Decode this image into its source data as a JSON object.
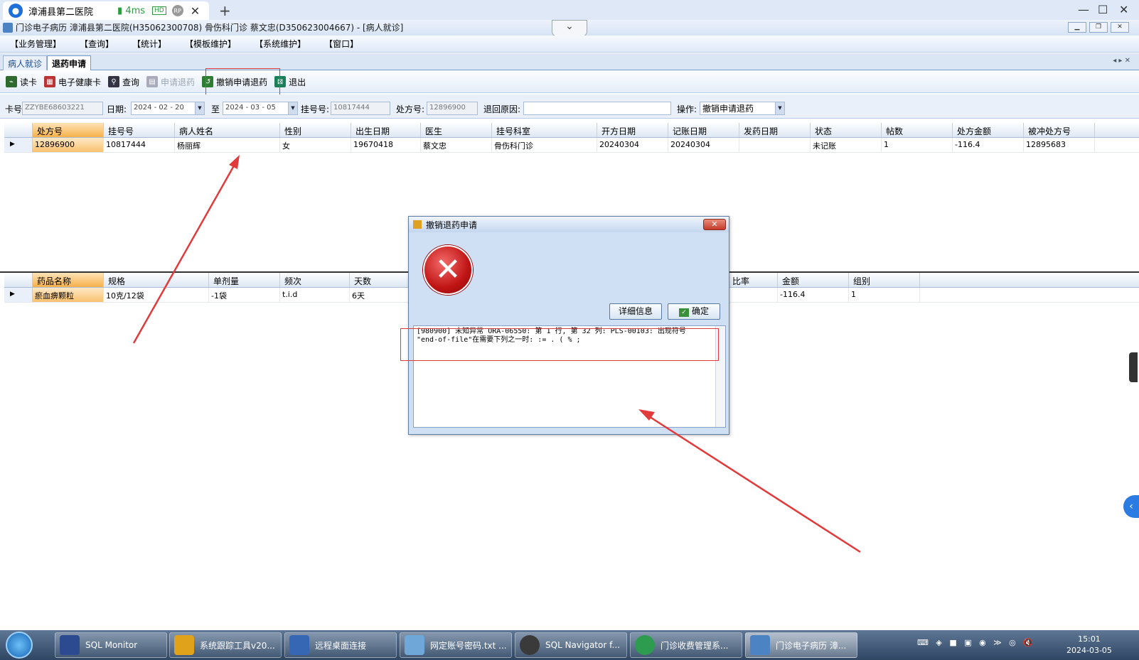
{
  "browser": {
    "tab_title": "漳浦县第二医院",
    "latency": "4ms",
    "hd": "HD",
    "rp": "RP"
  },
  "app": {
    "title": "门诊电子病历  漳浦县第二医院(H35062300708)  骨伤科门诊  蔡文忠(D350623004667) - [病人就诊]"
  },
  "menu": [
    "【业务管理】",
    "【查询】",
    "【统计】",
    "【模板维护】",
    "【系统维护】",
    "【窗口】"
  ],
  "doc_tabs": [
    "病人就诊",
    "退药申请"
  ],
  "toolbar": {
    "read_card": "读卡",
    "health_card": "电子健康卡",
    "query": "查询",
    "apply_return": "申请退药",
    "cancel_return": "撤销申请退药",
    "exit": "退出"
  },
  "filter": {
    "card_label": "卡号",
    "card_value": "ZZYBE68603221",
    "date_label": "日期:",
    "date_from": "2024 - 02 - 20",
    "to_label": "至",
    "date_to": "2024 - 03 - 05",
    "reg_label": "挂号号:",
    "reg_value": "10817444",
    "rx_label": "处方号:",
    "rx_value": "12896900",
    "reason_label": "退回原因:",
    "reason_value": "",
    "op_label": "操作:",
    "op_value": "撤销申请退药"
  },
  "grid1": {
    "headers": [
      "处方号",
      "挂号号",
      "病人姓名",
      "性别",
      "出生日期",
      "医生",
      "挂号科室",
      "开方日期",
      "记账日期",
      "发药日期",
      "状态",
      "帖数",
      "处方金额",
      "被冲处方号"
    ],
    "row": [
      "12896900",
      "10817444",
      "杨丽辉",
      "女",
      "19670418",
      "蔡文忠",
      "骨伤科门诊",
      "20240304",
      "20240304",
      "",
      "未记账",
      "1",
      "-116.4",
      "12895683"
    ]
  },
  "grid2": {
    "headers": [
      "药品名称",
      "规格",
      "单剂量",
      "频次",
      "天数",
      "比率",
      "金额",
      "组别"
    ],
    "row": [
      "瘀血痹颗粒",
      "10克/12袋",
      "-1袋",
      "t.i.d",
      "6天",
      "",
      "-116.4",
      "1"
    ]
  },
  "dialog": {
    "title": "撤销退药申请",
    "detail_btn": "详细信息",
    "ok_btn": "确定",
    "message_line1": "[980900] 未知异常 ORA-06550: 第 1 行, 第 32 列: PLS-00103: 出现符号",
    "message_line2": "\"end-of-file\"在需要下列之一时: := . ( % ;"
  },
  "taskbar": {
    "items": [
      "SQL Monitor",
      "系统跟踪工具v20...",
      "远程桌面连接",
      "网定账号密码.txt ...",
      "SQL Navigator f...",
      "门诊收费管理系...",
      "门诊电子病历  漳..."
    ],
    "time": "15:01",
    "date": "2024-03-05"
  },
  "colors": {
    "accent": "#2b7ce2",
    "annotation": "#e23a3a",
    "selected_header": "#f6b14a"
  }
}
